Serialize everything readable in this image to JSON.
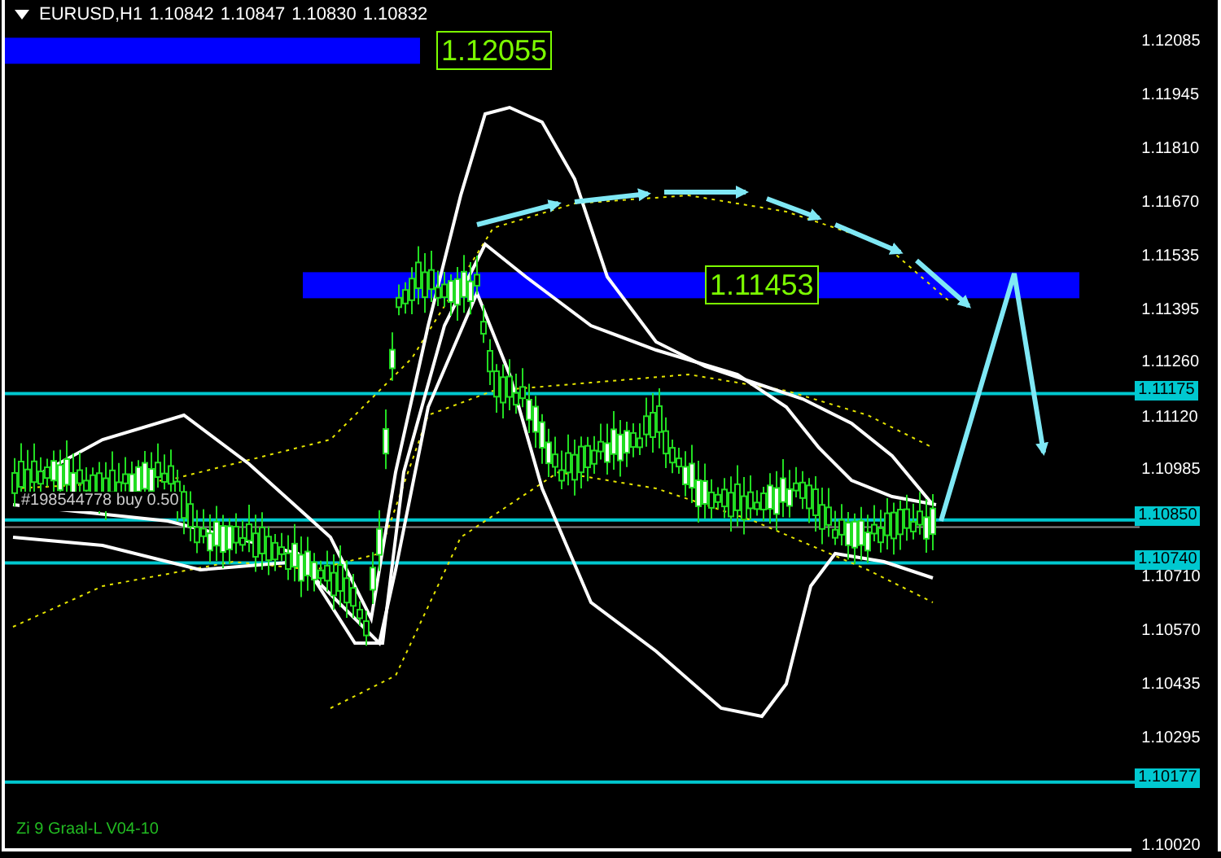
{
  "header": {
    "symbol": "EURUSD,H1",
    "quotes": [
      "1.10842",
      "1.10847",
      "1.10830",
      "1.10832"
    ]
  },
  "zones": [
    {
      "price": "1.12055"
    },
    {
      "price": "1.11453"
    }
  ],
  "levels": [
    {
      "price": "1.11175"
    },
    {
      "price": "1.10850"
    },
    {
      "price": "1.10740"
    },
    {
      "price": "1.10177"
    }
  ],
  "order_label": "#198544778 buy 0.50",
  "price_axis": {
    "ticks": [
      "1.12085",
      "1.11945",
      "1.11810",
      "1.11670",
      "1.11535",
      "1.11395",
      "1.11260",
      "1.11120",
      "1.10985",
      "1.10710",
      "1.10570",
      "1.10435",
      "1.10295",
      "1.10020"
    ]
  },
  "indicator_label": "Zi 9 Graal-L V04-10"
}
